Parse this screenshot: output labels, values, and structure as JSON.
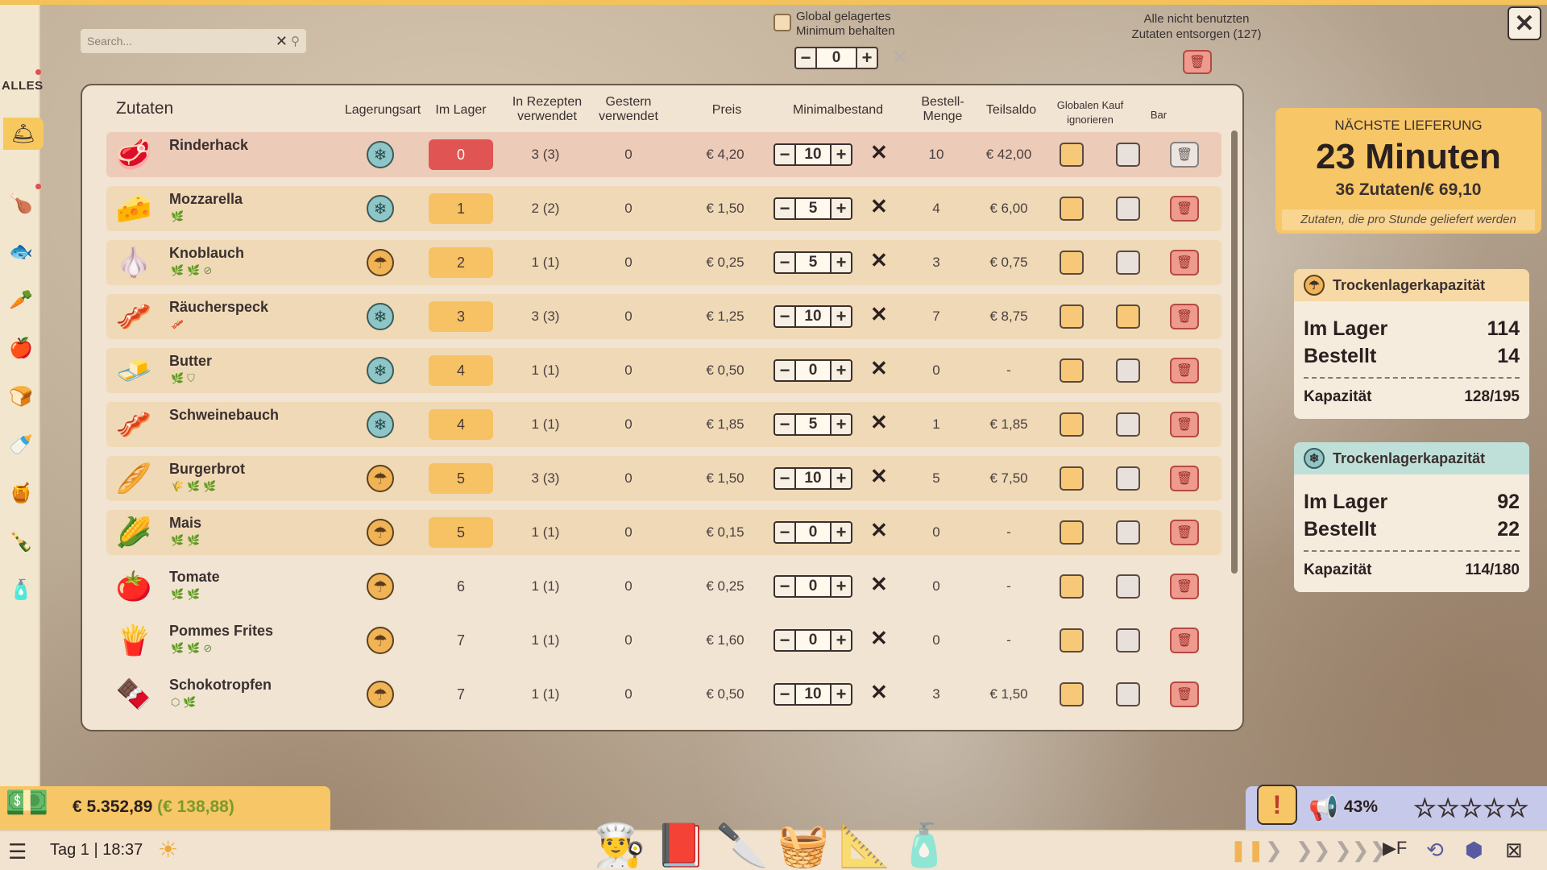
{
  "sidebar": {
    "all_label": "ALLES"
  },
  "search": {
    "placeholder": "Search..."
  },
  "global": {
    "keep_min_label_1": "Global gelagertes",
    "keep_min_label_2": "Minimum behalten",
    "global_min_value": "0",
    "dispose_label_1": "Alle nicht benutzten",
    "dispose_label_2": "Zutaten entsorgen (127)"
  },
  "table": {
    "headers": {
      "ingredients": "Zutaten",
      "storage": "Lagerungsart",
      "in_stock": "Im Lager",
      "in_recipes": "In Rezepten\nverwendet",
      "yesterday": "Gestern\nverwendet",
      "price": "Preis",
      "min_stock": "Minimalbestand",
      "order_qty": "Bestell-\nMenge",
      "subtotal": "Teilsaldo",
      "ignore_global": "Globalen Kauf\nignorieren",
      "bar": "Bar"
    },
    "rows": [
      {
        "name": "Rinderhack",
        "icon": "minced-beef",
        "tags": "",
        "storage": "cold",
        "stock": "0",
        "stock_style": "red",
        "recipes": "3 (3)",
        "yesterday": "0",
        "price": "€ 4,20",
        "min": "10",
        "order": "10",
        "subtotal": "€ 42,00",
        "bar_orange": false,
        "row_style": "red",
        "trash_disabled": true
      },
      {
        "name": "Mozzarella",
        "icon": "mozzarella",
        "tags": "🌿",
        "storage": "cold",
        "stock": "1",
        "stock_style": "orange",
        "recipes": "2 (2)",
        "yesterday": "0",
        "price": "€ 1,50",
        "min": "5",
        "order": "4",
        "subtotal": "€ 6,00",
        "bar_orange": false,
        "row_style": "normal",
        "trash_disabled": false
      },
      {
        "name": "Knoblauch",
        "icon": "garlic",
        "tags": "🌿🌿⊘",
        "storage": "dry",
        "stock": "2",
        "stock_style": "orange",
        "recipes": "1 (1)",
        "yesterday": "0",
        "price": "€ 0,25",
        "min": "5",
        "order": "3",
        "subtotal": "€ 0,75",
        "bar_orange": false,
        "row_style": "normal",
        "trash_disabled": false
      },
      {
        "name": "Räucherspeck",
        "icon": "bacon",
        "tags": "🥓",
        "storage": "cold",
        "stock": "3",
        "stock_style": "orange",
        "recipes": "3 (3)",
        "yesterday": "0",
        "price": "€ 1,25",
        "min": "10",
        "order": "7",
        "subtotal": "€ 8,75",
        "bar_orange": true,
        "row_style": "normal",
        "trash_disabled": false
      },
      {
        "name": "Butter",
        "icon": "butter",
        "tags": "🌿⛉",
        "storage": "cold",
        "stock": "4",
        "stock_style": "orange",
        "recipes": "1 (1)",
        "yesterday": "0",
        "price": "€ 0,50",
        "min": "0",
        "order": "0",
        "subtotal": "-",
        "bar_orange": false,
        "row_style": "normal",
        "trash_disabled": false
      },
      {
        "name": "Schweinebauch",
        "icon": "pork-belly",
        "tags": "",
        "storage": "cold",
        "stock": "4",
        "stock_style": "orange",
        "recipes": "1 (1)",
        "yesterday": "0",
        "price": "€ 1,85",
        "min": "5",
        "order": "1",
        "subtotal": "€ 1,85",
        "bar_orange": false,
        "row_style": "normal",
        "trash_disabled": false
      },
      {
        "name": "Burgerbrot",
        "icon": "burger-bun",
        "tags": "🌾🌿🌿",
        "storage": "dry",
        "stock": "5",
        "stock_style": "orange",
        "recipes": "3 (3)",
        "yesterday": "0",
        "price": "€ 1,50",
        "min": "10",
        "order": "5",
        "subtotal": "€ 7,50",
        "bar_orange": false,
        "row_style": "normal",
        "trash_disabled": false
      },
      {
        "name": "Mais",
        "icon": "corn",
        "tags": "🌿🌿",
        "storage": "dry",
        "stock": "5",
        "stock_style": "orange",
        "recipes": "1 (1)",
        "yesterday": "0",
        "price": "€ 0,15",
        "min": "0",
        "order": "0",
        "subtotal": "-",
        "bar_orange": false,
        "row_style": "normal",
        "trash_disabled": false
      },
      {
        "name": "Tomate",
        "icon": "tomato",
        "tags": "🌿🌿",
        "storage": "dry",
        "stock": "6",
        "stock_style": "none",
        "recipes": "1 (1)",
        "yesterday": "0",
        "price": "€ 0,25",
        "min": "0",
        "order": "0",
        "subtotal": "-",
        "bar_orange": false,
        "row_style": "plain",
        "trash_disabled": false
      },
      {
        "name": "Pommes Frites",
        "icon": "fries",
        "tags": "🌿🌿⊘",
        "storage": "dry",
        "stock": "7",
        "stock_style": "none",
        "recipes": "1 (1)",
        "yesterday": "0",
        "price": "€ 1,60",
        "min": "0",
        "order": "0",
        "subtotal": "-",
        "bar_orange": false,
        "row_style": "plain",
        "trash_disabled": false
      },
      {
        "name": "Schokotropfen",
        "icon": "chocolate-chips",
        "tags": "⬡🌿",
        "storage": "dry",
        "stock": "7",
        "stock_style": "none",
        "recipes": "1 (1)",
        "yesterday": "0",
        "price": "€ 0,50",
        "min": "10",
        "order": "3",
        "subtotal": "€ 1,50",
        "bar_orange": false,
        "row_style": "plain",
        "trash_disabled": false
      }
    ]
  },
  "next_delivery": {
    "label": "NÄCHSTE LIEFERUNG",
    "time": "23 Minuten",
    "summary": "36 Zutaten/€ 69,10",
    "note": "Zutaten, die pro Stunde geliefert werden"
  },
  "dry_storage": {
    "title": "Trockenlagerkapazität",
    "in_stock_label": "Im Lager",
    "in_stock": "114",
    "ordered_label": "Bestellt",
    "ordered": "14",
    "capacity_label": "Kapazität",
    "capacity": "128/195"
  },
  "cold_storage": {
    "title": "Trockenlagerkapazität",
    "in_stock_label": "Im Lager",
    "in_stock": "92",
    "ordered_label": "Bestellt",
    "ordered": "22",
    "capacity_label": "Kapazität",
    "capacity": "114/180"
  },
  "status": {
    "money": "€ 5.352,89",
    "money_diff": "(€ 138,88)",
    "time": "Tag 1 | 18:37",
    "rating_pct": "43%",
    "stars": "☆☆☆☆☆",
    "star_rating": 0
  },
  "colors": {
    "accent": "#f7c666",
    "danger": "#e05454",
    "cold": "#8ec6c8",
    "dry": "#f0b456"
  }
}
